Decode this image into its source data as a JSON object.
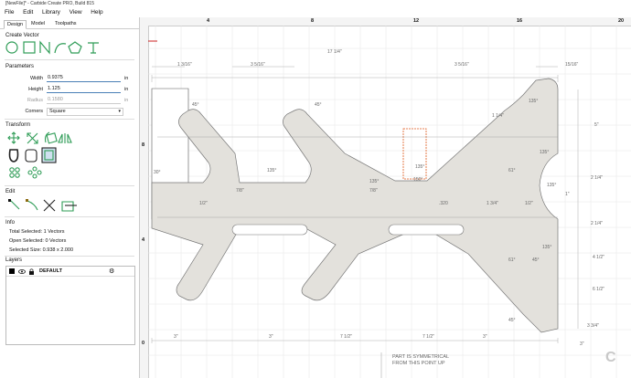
{
  "window": {
    "title": "[NewFile]* - Carbide Create PRO, Build 815"
  },
  "menu": [
    "File",
    "Edit",
    "Library",
    "View",
    "Help"
  ],
  "tabs": [
    "Design",
    "Model",
    "Toolpaths"
  ],
  "sections": {
    "create_vector": "Create Vector",
    "parameters": "Parameters",
    "transform": "Transform",
    "edit": "Edit",
    "info": "Info",
    "layers": "Layers"
  },
  "parameters": {
    "width_label": "Width",
    "width_value": "0.9375",
    "width_unit": "in",
    "height_label": "Height",
    "height_value": "1.125",
    "height_unit": "in",
    "radius_label": "Radius",
    "radius_value": "0.1580",
    "radius_unit": "in",
    "corners_label": "Corners",
    "corners_value": "Square"
  },
  "info": {
    "total_selected": "Total Selected:   1 Vectors",
    "open_selected": "Open Selected:   0 Vectors",
    "selected_size": "Selected Size:    0.938 x 2.000"
  },
  "layers": [
    {
      "name": "DEFAULT",
      "color": "#000000"
    }
  ],
  "ruler": {
    "top": [
      "4",
      "8",
      "12",
      "16",
      "20"
    ],
    "left": [
      "8",
      "4",
      "0"
    ]
  },
  "drawing": {
    "dims_top": [
      "1 3/16\"",
      "3 5/16\"",
      "17 1/4\"",
      "3 5/16\"",
      "15/16\""
    ],
    "dims_bottom": [
      "3\"",
      "3\"",
      "7 1/2\"",
      "7 1/2\"",
      "3\"",
      "3\""
    ],
    "dims_right": [
      "5\"",
      "2 1/4\"",
      "1\"",
      "2 1/4\"",
      "4 1/2\"",
      "6 1/2\""
    ],
    "angles": [
      "45°",
      "45°",
      "135°",
      "135°",
      "135°",
      "135°",
      "135°",
      "135°",
      "30°",
      "45°",
      "61°",
      "61°",
      "150°",
      "135°",
      "45°"
    ],
    "misc": [
      "7/8\"",
      "1/2\"",
      "7/8\"",
      "1/2\"",
      ".320",
      "1 3/4\"",
      "1 1/4\"",
      "3 3/4\""
    ],
    "note_line1": "PART IS SYMMETRICAL",
    "note_line2": "FROM THIS POINT UP",
    "watermark": "C"
  },
  "colors": {
    "accent": "#4a7fb6",
    "part_fill": "#e3e1dc",
    "selection": "#e05a1c"
  }
}
